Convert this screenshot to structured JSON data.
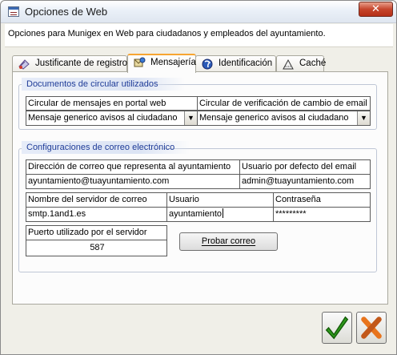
{
  "window": {
    "title": "Opciones de Web",
    "close_symbol": "✕"
  },
  "header": {
    "description": "Opciones para Munigex en Web para ciudadanos y empleados del ayuntamiento."
  },
  "tabs": [
    {
      "label": "Justificante de registro",
      "icon": "certificate-icon"
    },
    {
      "label": "Mensajería",
      "icon": "messaging-icon",
      "active": true
    },
    {
      "label": "Identificación",
      "icon": "identification-icon"
    },
    {
      "label": "Caché",
      "icon": "cache-icon"
    }
  ],
  "documents_group": {
    "title": "Documentos de circular utilizados",
    "portal_message_label": "Circular de mensajes en portal web",
    "portal_message_value": "Mensaje generico avisos al ciudadano",
    "email_change_label": "Circular de verificación de cambio de email",
    "email_change_value": "Mensaje generico avisos al ciudadano"
  },
  "email_group": {
    "title": "Configuraciones de correo electrónico",
    "town_email_label": "Dirección de correo que representa al ayuntamiento",
    "town_email_value": "ayuntamiento@tuayuntamiento.com",
    "default_user_email_label": "Usuario por defecto del email",
    "default_user_email_value": "admin@tuayuntamiento.com",
    "server_label": "Nombre del servidor de correo",
    "server_value": "smtp.1and1.es",
    "user_label": "Usuario",
    "user_value": "ayuntamiento",
    "password_label": "Contraseña",
    "password_value": "*********",
    "port_label": "Puerto utilizado por el servidor",
    "port_value": "587",
    "test_button": "Probar correo"
  },
  "footer": {
    "ok_icon": "checkmark-icon",
    "cancel_icon": "cross-icon"
  },
  "colors": {
    "group_title": "#1f3c98",
    "active_tab_accent": "#f7a532",
    "ok_green": "#2e9a1c",
    "cancel_orange": "#e8741c"
  }
}
